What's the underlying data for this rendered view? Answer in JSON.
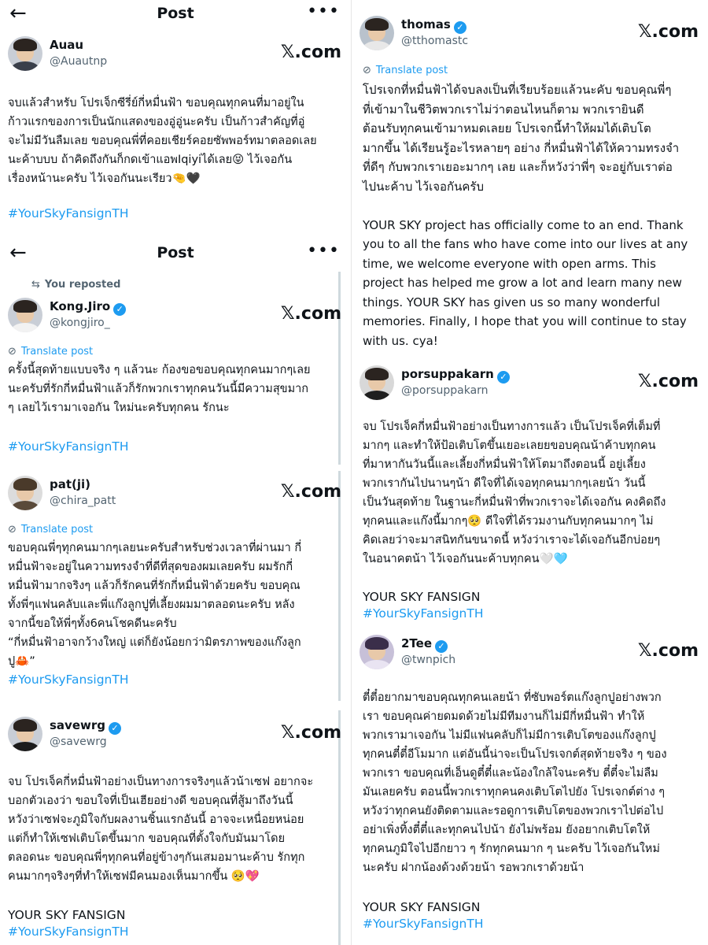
{
  "colors": {
    "accent": "#1d9bf0",
    "text": "#0f1419",
    "muted": "#536471"
  },
  "header": {
    "title": "Post",
    "back_icon": "←",
    "more_icon": "•••"
  },
  "common": {
    "xcom": "𝕏.com",
    "translate": "Translate post",
    "translate_icon": "⊘",
    "reposted": "You reposted",
    "repost_icon": "⇆",
    "verified_icon": "✓",
    "hashtag": "#YourSkyFansignTH",
    "fansign": "YOUR SKY FANSIGN"
  },
  "posts": {
    "auau": {
      "name": "Auau",
      "handle": "@Auautnp",
      "text": "จบแล้วสำหรับ โปรเจ็กซีรี่ย์กี่หมื่นฟ้า ขอบคุณทุกคนที่มาอยู่ใน\nก้าวแรกของการเป็นนักแสดงของอู่อู่นะครับ เป็นก้าวสำคัญที่อู่\nจะไม่มีวันลืมเลย ขอบคุณพี่ที่คอยเชียร์คอยซัพพอร์ทมาตลอดเลย\nนะค้าบบบ ถ้าคิดถึงกันก็กดเข้าแอพIqiyiได้เลย😝 ไว้เจอกัน\nเรื่องหน้านะครับ ไว้เจอกันนะเรียว🤏🖤"
    },
    "kongjiro": {
      "name": "Kong.Jiro",
      "handle": "@kongjiro_",
      "text": "ครั้งนี้สุดท้ายแบบจริง ๆ แล้วนะ ก้องขอขอบคุณทุกคนมากๆเลย\nนะครับที่รักกี่หมื่นฟ้าแล้วก็รักพวกเราทุกคนวันนี้มีความสุขมาก\nๆ เลยไว้เรามาเจอกัน ใหม่นะครับทุกคน รักนะ"
    },
    "patji": {
      "name": "pat(ji)",
      "handle": "@chira_patt",
      "text": "ขอบคุณพี่ๆทุกคนมากๆเลยนะครับสำหรับช่วงเวลาที่ผ่านมา กี่\nหมื่นฟ้าจะอยู่ในความทรงจำที่ดีที่สุดของผมเลยครับ ผมรักกี่\nหมื่นฟ้ามากจริงๆ แล้วก็รักคนที่รักกี่หมื่นฟ้าด้วยครับ ขอบคุณ\nทั้งพี่ๆแฟนคลับและพี่แก๊งลูกปูที่เลี้ยงผมมาตลอดนะครับ หลัง\nจากนี้ขอให้พี่ๆทั้ง6คนโชคดีนะครับ\n“กี่หมื่นฟ้าอาจกว้างใหญ่ แต่ก็ยังน้อยกว่ามิตรภาพของแก๊งลูก\nปู🦀”"
    },
    "savewrg": {
      "name": "savewrg",
      "handle": "@savewrg",
      "text": "จบ โปรเจ็คกี่หมื่นฟ้าอย่างเป็นทางการจริงๆแล้วน้าเซฟ อยากจะ\nบอกตัวเองว่า ขอบใจที่เป็นเฮียอย่างดี ขอบคุณที่สู้มาถึงวันนี้\nหวังว่าเซฟจะภูมิใจกับผลงานชิ้นแรกอันนี้ อาจจะเหนื่อยหน่อย\nแต่ก็ทำให้เซฟเติบโตขึ้นมาก ขอบคุณที่ตั้งใจกับมันมาโดย\nตลอดนะ ขอบคุณพี่ๆทุกคนที่อยู่ข้างๆกันเสมอมานะค้าบ รักทุก\nคนมากๆจริงๆที่ทำให้เซฟมีคนมองเห็นมากขึ้น 🥺💖"
    },
    "thomas": {
      "name": "thomas",
      "handle": "@tthomastc",
      "text": "โปรเจกที่หมื่นฟ้าได้จบลงเป็นที่เรียบร้อยแล้วนะคับ ขอบคุณพี่ๆ\nที่เข้ามาในชีวิตพวกเราไม่ว่าตอนไหนก็ตาม พวกเรายินดี\nต้อนรับทุกคนเข้ามาหมดเลยย โปรเจกนี้ทำให้ผมได้เติบโต\nมากขึ้น ได้เรียนรู้อะไรหลายๆ อย่าง กี่หมื่นฟ้าได้ให้ความทรงจำ\nที่ดีๆ กับพวกเราเยอะมากๆ เลย และก็หวังว่าพี่ๆ จะอยู่กับเราต่อ\nไปนะค้าบ ไว้เจอกันครับ\n\nYOUR SKY project has officially come to an end. Thank\nyou to all the fans who have come into our lives at any\ntime, we welcome everyone with open arms. This\nproject has helped me grow a lot and learn many new\nthings. YOUR SKY has given us so many wonderful\nmemories. Finally, I hope that you will continue to stay\nwith us. cya!"
    },
    "porsuppakarn": {
      "name": "porsuppakarn",
      "handle": "@porsuppakarn",
      "text": "จบ โปรเจ็คกี่หมื่นฟ้าอย่างเป็นทางการแล้ว เป็นโปรเจ็คที่เต็มที่\nมากๆ และทำให้ป้อเติบโตขึ้นเยอะเลยยขอบคุณน้าค้าบทุกคน\nที่มาหากันวันนี้และเลี้ยงกี่หมื่นฟ้าให้โตมาถึงตอนนี้ อยู่เลี้ยง\nพวกเรากันไปนานๆน้า ดีใจที่ได้เจอทุกคนมากๆเลยน้า วันนี้\nเป็นวันสุดท้าย ในฐานะกี่หมื่นฟ้าที่พวกเราจะได้เจอกัน คงคิดถึง\nทุกคนและแก๊งนี้มากๆ🥺 ดีใจที่ได้รวมงานกับทุกคนมากๆ ไม่\nคิดเลยว่าจะมาสนิทกันขนาดนี้ หวังว่าเราจะได้เจอกันอีกบ่อยๆ\nในอนาคตน้า ไว้เจอกันนะค้าบทุกคน🤍🩵"
    },
    "twotee": {
      "name": "2Tee",
      "handle": "@twnpich",
      "text": "ตี๋ตี๋อยากมาขอบคุณทุกคนเลยน้า ที่ซับพอร์ตแก๊งลูกปูอย่างพวก\nเรา ขอบคุณค่ายดมดด้วยไม่มีทีมงานก็ไม่มีกี่หมื่นฟ้า ทำให้\nพวกเรามาเจอกัน ไม่มีแฟนคลับก็ไม่มีการเติบโตของแก๊งลูกปู\nทุกคนตี๋ตี๋อีโมมาก แต่อันนี้น่าจะเป็นโปรเจกต์สุดท้ายจริง ๆ ของ\nพวกเรา ขอบคุณที่เอ็นดูตี๋ตี๋และน้องใกล้ใจนะครับ ตี๋ตี๋จะไม่ลืม\nมันเลยครับ ตอนนี้พวกเราทุกคนคงเติบโตไปยัง โปรเจกต์ต่าง ๆ\nหวังว่าทุกคนยังติดตามและรอดูการเติบโตของพวกเราไปต่อไป\nอย่าเพิ่งทิ้งตี๋ตี๋และทุกคนไปน้า ยังไม่พร้อม ยังอยากเติบโตให้\nทุกคนภูมิใจไปอีกยาว ๆ รักทุกคนมาก ๆ นะครับ ไว้เจอกันใหม่\nนะครับ ฝากน้องด้วงด้วยน้า รอพวกเราด้วยน้า"
    }
  }
}
